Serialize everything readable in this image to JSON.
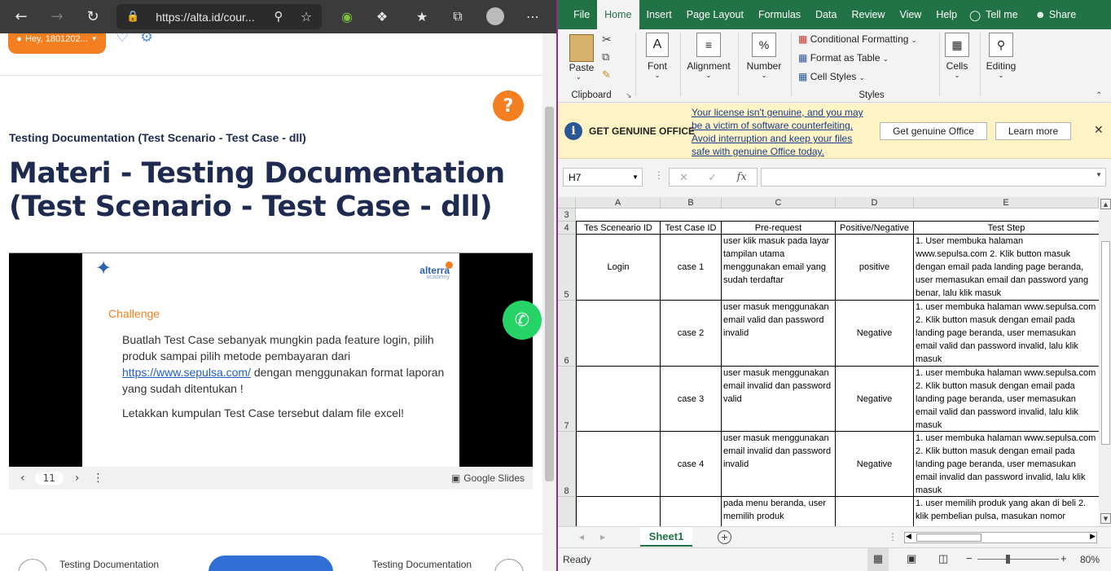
{
  "browser": {
    "url": "https://alta.id/cour...",
    "user_greeting": "Hey, 1801202...",
    "breadcrumb": "Testing Documentation (Test Scenario - Test Case - dll)",
    "page_title": "Materi - Testing Documentation (Test Scenario - Test Case - dll)",
    "help_label": "?",
    "slide": {
      "brand": "alterra",
      "brand_sub": "academy",
      "title": "Challenge",
      "line1": "Buatlah Test Case sebanyak mungkin pada feature login, pilih produk sampai pilih metode pembayaran dari",
      "link": "https://www.sepulsa.com/",
      "line2": " dengan menggunakan format laporan yang sudah ditentukan !",
      "line3": "Letakkan kumpulan Test Case tersebut dalam file excel!",
      "page_number": "11",
      "provider": "Google Slides"
    },
    "nav_prev": "Testing Documentation",
    "nav_next": "Testing Documentation"
  },
  "excel": {
    "menu": [
      "File",
      "Home",
      "Insert",
      "Page Layout",
      "Formulas",
      "Data",
      "Review",
      "View",
      "Help",
      "Tell me",
      "Share"
    ],
    "active_menu": "Home",
    "ribbon": {
      "paste": "Paste",
      "clipboard": "Clipboard",
      "font": "Font",
      "alignment": "Alignment",
      "number": "Number",
      "conditional_formatting": "Conditional Formatting",
      "format_as_table": "Format as Table",
      "cell_styles": "Cell Styles",
      "styles": "Styles",
      "cells": "Cells",
      "editing": "Editing"
    },
    "license": {
      "title": "GET GENUINE OFFICE",
      "message": "Your license isn't genuine, and you may be a victim of software counterfeiting. Avoid interruption and keep your files safe with genuine Office today.",
      "button_genuine": "Get genuine Office",
      "button_learn": "Learn more"
    },
    "name_box": "H7",
    "formula": "",
    "columns": [
      "A",
      "B",
      "C",
      "D",
      "E"
    ],
    "rows": [
      "3",
      "4",
      "5",
      "6",
      "7",
      "8"
    ],
    "headers": [
      "Tes Sceneario ID",
      "Test  Case ID",
      "Pre-request",
      "Positive/Negative",
      "Test Step"
    ],
    "data": [
      [
        "Login",
        "case 1",
        "user klik masuk pada layar tampilan utama menggunakan email yang sudah terdaftar",
        "positive",
        "1. User membuka halaman www.sepulsa.com    2. Klik button masuk dengan email pada landing page beranda, user memasukan  email dan password yang benar, lalu klik masuk"
      ],
      [
        "",
        "case 2",
        "user masuk menggunakan email valid dan password invalid",
        "Negative",
        "1. user membuka halaman www.sepulsa.com    2. Klik button masuk dengan email pada landing page beranda, user memasukan  email valid dan password invalid, lalu klik masuk"
      ],
      [
        "",
        "case 3",
        "user masuk menggunakan email invalid dan password valid",
        "Negative",
        "1. user membuka halaman www.sepulsa.com    2. Klik button masuk dengan email pada landing page beranda, user memasukan  email valid dan password invalid, lalu klik masuk"
      ],
      [
        "",
        "case 4",
        "user masuk menggunakan email invalid dan password invalid",
        "Negative",
        "1. user membuka halaman www.sepulsa.com    2. Klik button masuk dengan email pada landing page beranda, user memasukan  email invalid dan password invalid, lalu klik masuk"
      ],
      [
        "",
        "",
        "pada menu beranda, user memilih produk",
        "",
        "1. user memilih produk yang akan di beli 2. klik pembelian pulsa, masukan nomor"
      ]
    ],
    "sheet_tab": "Sheet1",
    "status": "Ready",
    "zoom": "80%"
  }
}
